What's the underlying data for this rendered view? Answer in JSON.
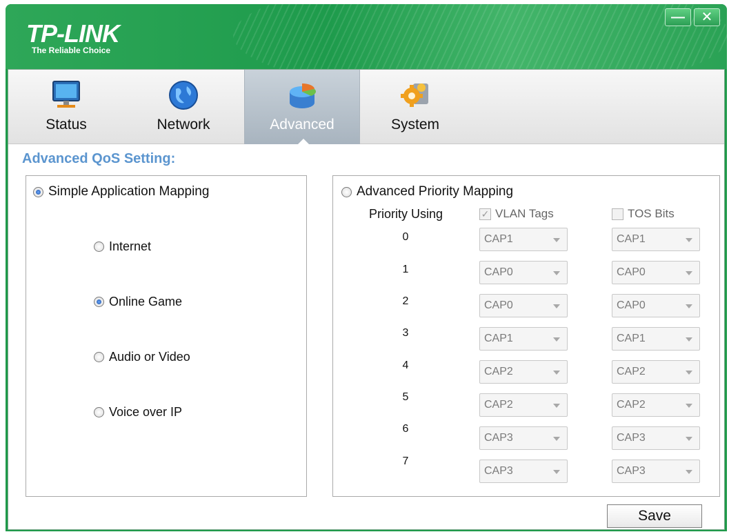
{
  "window": {
    "brand_name": "TP-LINK",
    "brand_tagline": "The Reliable Choice",
    "minimize_glyph": "—",
    "close_glyph": "✕"
  },
  "tabs": [
    {
      "label": "Status",
      "icon": "monitor-icon",
      "active": false
    },
    {
      "label": "Network",
      "icon": "globe-icon",
      "active": false
    },
    {
      "label": "Advanced",
      "icon": "pie-chart-icon",
      "active": true
    },
    {
      "label": "System",
      "icon": "gears-icon",
      "active": false
    }
  ],
  "page": {
    "section_title": "Advanced QoS Setting:"
  },
  "simple_mapping": {
    "label": "Simple Application Mapping",
    "selected": true,
    "options": [
      {
        "label": "Internet",
        "selected": false
      },
      {
        "label": "Online Game",
        "selected": true
      },
      {
        "label": "Audio or Video",
        "selected": false
      },
      {
        "label": "Voice over IP",
        "selected": false
      }
    ]
  },
  "advanced_mapping": {
    "label": "Advanced Priority Mapping",
    "selected": false,
    "priority_using_label": "Priority Using",
    "vlan_tags": {
      "label": "VLAN Tags",
      "checked": true,
      "enabled": false
    },
    "tos_bits": {
      "label": "TOS Bits",
      "checked": false,
      "enabled": false
    },
    "rows": [
      {
        "priority": "0",
        "vlan": "CAP1",
        "tos": "CAP1"
      },
      {
        "priority": "1",
        "vlan": "CAP0",
        "tos": "CAP0"
      },
      {
        "priority": "2",
        "vlan": "CAP0",
        "tos": "CAP0"
      },
      {
        "priority": "3",
        "vlan": "CAP1",
        "tos": "CAP1"
      },
      {
        "priority": "4",
        "vlan": "CAP2",
        "tos": "CAP2"
      },
      {
        "priority": "5",
        "vlan": "CAP2",
        "tos": "CAP2"
      },
      {
        "priority": "6",
        "vlan": "CAP3",
        "tos": "CAP3"
      },
      {
        "priority": "7",
        "vlan": "CAP3",
        "tos": "CAP3"
      }
    ]
  },
  "footer": {
    "save_label": "Save"
  },
  "colors": {
    "brand_green": "#1f9a4a",
    "section_title": "#5b95cf",
    "active_tab": "#a8b4bf"
  }
}
